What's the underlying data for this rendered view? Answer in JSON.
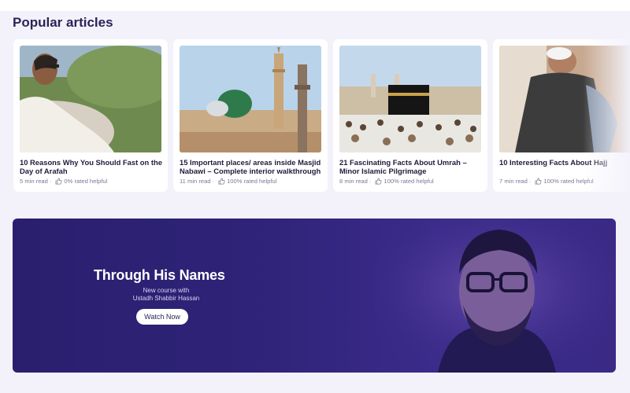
{
  "section": {
    "title": "Popular articles"
  },
  "articles": [
    {
      "title": "10 Reasons Why You Should Fast on the Day of Arafah",
      "read_time": "5 min read",
      "rating": "0% rated helpful",
      "image": "man-profile-outdoor"
    },
    {
      "title": "15 Important places/ areas inside Masjid Nabawi – Complete interior walkthrough",
      "read_time": "11 min read",
      "rating": "100% rated helpful",
      "image": "green-dome-mosque"
    },
    {
      "title": "21 Fascinating Facts About Umrah – Minor Islamic Pilgrimage",
      "read_time": "8 min read",
      "rating": "100% rated helpful",
      "image": "kaaba-crowd"
    },
    {
      "title": "10 Interesting Facts About Hajj",
      "read_time": "7 min read",
      "rating": "100% rated helpful",
      "image": "pilgrim-back-view"
    }
  ],
  "meta_separator": "·",
  "banner": {
    "title": "Through His Names",
    "subtitle_line1": "New course with",
    "subtitle_line2": "Ustadh Shabbir Hassan",
    "cta_label": "Watch Now"
  },
  "colors": {
    "heading": "#2a2456",
    "section_bg": "#f3f2fb",
    "banner_start": "#2a1f6e",
    "banner_end": "#3a2a86",
    "meta_text": "#7b7996"
  }
}
